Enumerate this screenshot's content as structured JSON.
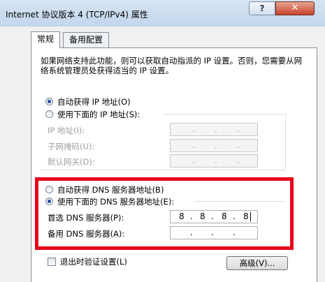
{
  "window": {
    "title": "Internet 协议版本 4 (TCP/IPv4) 属性",
    "help_label": "?",
    "close_label": "✕"
  },
  "tabs": [
    {
      "label": "常规",
      "active": true
    },
    {
      "label": "备用配置",
      "active": false
    }
  ],
  "description": "如果网络支持此功能，则可以获取自动指派的 IP 设置。否则，您需要从网络系统管理员处获得适当的 IP 设置。",
  "ip_section": {
    "auto_label": "自动获得 IP 地址(O)",
    "manual_label": "使用下面的 IP 地址(S):",
    "selected": "auto",
    "fields": [
      {
        "label": "IP 地址(I):",
        "value": ". . ."
      },
      {
        "label": "子网掩码(U):",
        "value": ". . ."
      },
      {
        "label": "默认网关(D):",
        "value": ". . ."
      }
    ]
  },
  "dns_section": {
    "auto_label": "自动获得 DNS 服务器地址(B)",
    "manual_label": "使用下面的 DNS 服务器地址(E):",
    "selected": "manual",
    "preferred": {
      "label": "首选 DNS 服务器(P):",
      "octets": [
        "8",
        "8",
        "8",
        "8"
      ]
    },
    "alternate": {
      "label": "备用 DNS 服务器(A):",
      "octets": [
        "",
        "",
        "",
        ""
      ]
    },
    "highlight_color": "#e6001c"
  },
  "footer": {
    "validate_label": "退出时验证设置(L)",
    "validate_checked": false,
    "advanced_label": "高级(V)..."
  }
}
